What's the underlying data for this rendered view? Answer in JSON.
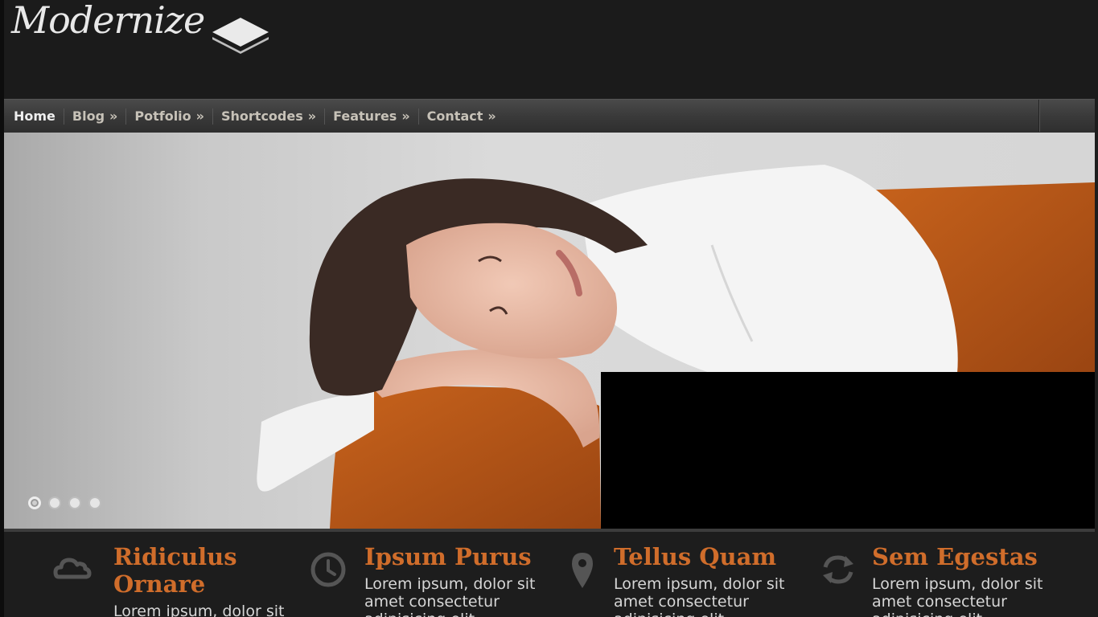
{
  "header": {
    "logo_text": "Modernize"
  },
  "nav": {
    "items": [
      {
        "label": "Home",
        "has_submenu": false
      },
      {
        "label": "Blog",
        "has_submenu": true
      },
      {
        "label": "Potfolio",
        "has_submenu": true
      },
      {
        "label": "Shortcodes",
        "has_submenu": true
      },
      {
        "label": "Features",
        "has_submenu": true
      },
      {
        "label": "Contact",
        "has_submenu": true
      }
    ],
    "submenu_marker": "»"
  },
  "slider": {
    "slide_count": 4,
    "active_index": 0
  },
  "features": [
    {
      "title": "Ridiculus Ornare",
      "text": "Lorem ipsum, dolor sit",
      "icon": "cloud-icon"
    },
    {
      "title": "Ipsum Purus",
      "text": "Lorem ipsum, dolor sit amet consectetur adipisicing elit",
      "icon": "clock-icon"
    },
    {
      "title": "Tellus Quam",
      "text": "Lorem ipsum, dolor sit amet consectetur adipisicing elit",
      "icon": "map-pin-icon"
    },
    {
      "title": "Sem Egestas",
      "text": "Lorem ipsum, dolor sit amet consectetur adipisicing elit",
      "icon": "refresh-icon"
    }
  ],
  "colors": {
    "accent": "#d06d2b",
    "background": "#1d1d1d",
    "nav_text": "#c7c2b8"
  }
}
